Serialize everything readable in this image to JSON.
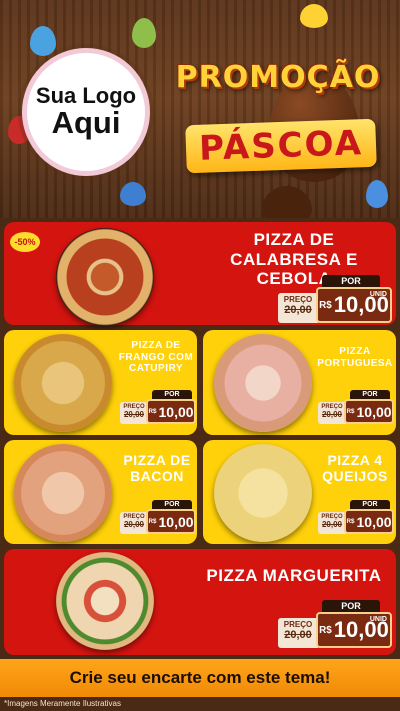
{
  "header": {
    "logo_line1": "Sua Logo",
    "logo_line2": "Aqui",
    "promo_title": "PROMOÇÃO",
    "promo_sub": "PÁSCOA"
  },
  "badge": "-50%",
  "price_labels": {
    "preco": "PREÇO",
    "por": "POR",
    "currency": "R$",
    "unid": "UNID"
  },
  "pizzas": [
    {
      "name": "PIZZA DE CALABRESA E CEBOLA",
      "old_price": "20,00",
      "new_price": "10,00"
    },
    {
      "name": "PIZZA DE FRANGO COM CATUPIRY",
      "old_price": "20,00",
      "new_price": "10,00"
    },
    {
      "name": "PIZZA PORTUGUESA",
      "old_price": "20,00",
      "new_price": "10,00"
    },
    {
      "name": "PIZZA DE BACON",
      "old_price": "20,00",
      "new_price": "10,00"
    },
    {
      "name": "PIZZA 4 QUEIJOS",
      "old_price": "20,00",
      "new_price": "10,00"
    },
    {
      "name": "PIZZA MARGUERITA",
      "old_price": "20,00",
      "new_price": "10,00"
    }
  ],
  "cta": "Crie seu encarte com este tema!",
  "footnote": "*Imagens Meramente Ilustrativas",
  "colors": {
    "red": "#d4140f",
    "yellow": "#ffd10a",
    "wood": "#5b341a",
    "gold": "#ffd23a"
  }
}
